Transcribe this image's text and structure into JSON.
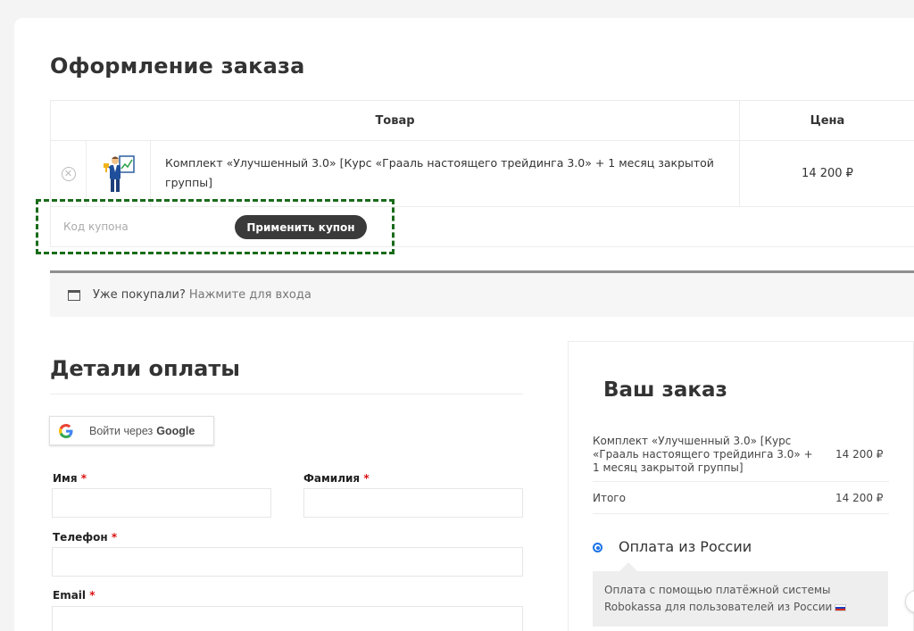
{
  "page": {
    "title": "Оформление заказа"
  },
  "cart": {
    "col_product": "Товар",
    "col_price": "Цена",
    "items": [
      {
        "name": "Комплект «Улучшенный 3.0» [Курс «Грааль настоящего трейдинга 3.0» + 1 месяц закрытой группы]",
        "price": "14 200 ₽",
        "remove_icon": "close-circle-icon"
      }
    ],
    "coupon_placeholder": "Код купона",
    "coupon_button": "Применить купон"
  },
  "login_notice": {
    "icon": "window-icon",
    "question": "Уже покупали?",
    "link": "Нажмите для входа"
  },
  "billing": {
    "title": "Детали оплаты",
    "google_prefix": "Войти через",
    "google_brand": "Google",
    "required_mark": "*",
    "first_name_label": "Имя",
    "last_name_label": "Фамилия",
    "phone_label": "Телефон",
    "email_label": "Email"
  },
  "order": {
    "title": "Ваш заказ",
    "item_name": "Комплект «Улучшенный 3.0» [Курс «Грааль настоящего трейдинга 3.0» + 1 месяц закрытой группы]",
    "item_price": "14 200 ₽",
    "total_label": "Итого",
    "total_value": "14 200 ₽",
    "payment_method": "Оплата из России",
    "payment_description": "Оплата с помощью платёжной системы Robokassa для пользователей из России"
  },
  "colors": {
    "button_dark": "#3a3a3a",
    "highlight_dashed": "#1a6b1a",
    "radio_accent": "#1a73e8",
    "required": "#dd1111"
  }
}
